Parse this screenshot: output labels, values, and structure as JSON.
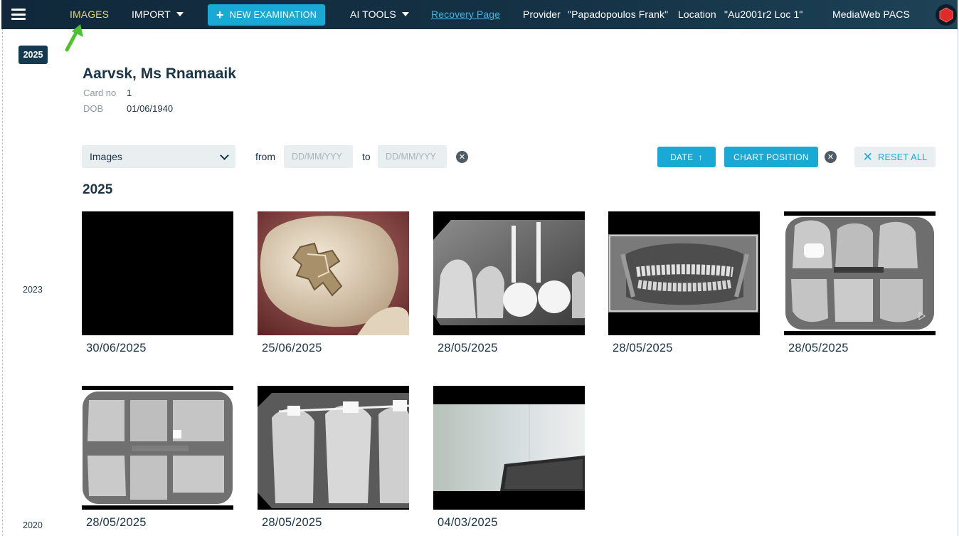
{
  "topbar": {
    "menu_icon": "hamburger-menu-icon",
    "images": "IMAGES",
    "import": "IMPORT",
    "new_examination": "NEW EXAMINATION",
    "ai_tools": "AI TOOLS",
    "recovery_page": "Recovery Page",
    "provider_label": "Provider",
    "provider_value": "\"Papadopoulos Frank\"",
    "location_label": "Location",
    "location_value": "\"Au2001r2 Loc 1\"",
    "app_name": "MediaWeb PACS",
    "logo_icon": "hexagon-logo-icon"
  },
  "timeline": {
    "active_year": "2025",
    "years": [
      "2023",
      "2020"
    ]
  },
  "patient": {
    "name": "Aarvsk, Ms Rnamaaik",
    "card_label": "Card no",
    "card_value": "1",
    "dob_label": "DOB",
    "dob_value": "01/06/1940"
  },
  "filters": {
    "type_value": "Images",
    "from_label": "from",
    "to_label": "to",
    "from_placeholder": "DD/MM/YYY",
    "to_placeholder": "DD/MM/YYY",
    "date_button": "DATE",
    "chart_position_button": "CHART POSITION",
    "reset_all": "RESET ALL"
  },
  "section": {
    "year": "2025"
  },
  "images": [
    {
      "date": "30/06/2025",
      "kind": "black"
    },
    {
      "date": "25/06/2025",
      "kind": "intraoral-photo"
    },
    {
      "date": "28/05/2025",
      "kind": "periapical-xray"
    },
    {
      "date": "28/05/2025",
      "kind": "panoramic-xray"
    },
    {
      "date": "28/05/2025",
      "kind": "bitewing-xray"
    },
    {
      "date": "28/05/2025",
      "kind": "bitewing-xray"
    },
    {
      "date": "28/05/2025",
      "kind": "periapical-braces-xray"
    },
    {
      "date": "04/03/2025",
      "kind": "room-photo"
    }
  ],
  "colors": {
    "topbar": "#10283a",
    "accent": "#1aa8d4",
    "active_nav": "#e6d76f",
    "link": "#3fb3e2",
    "annotation_arrow": "#4cc22e"
  }
}
